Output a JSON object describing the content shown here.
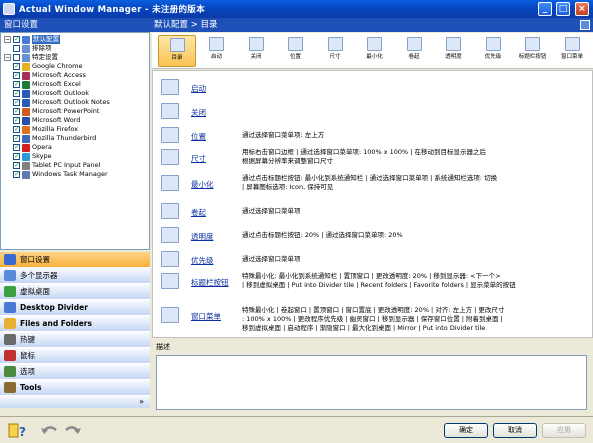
{
  "window": {
    "title": "Actual Window Manager - 未注册的版本",
    "controls": [
      "_",
      "□",
      "×"
    ]
  },
  "left_panel": {
    "header": "窗口设置",
    "tree": [
      {
        "indent": 0,
        "expander": "−",
        "checked": true,
        "icon_color": "#4a7ad8",
        "label": "默认配置",
        "selected": true
      },
      {
        "indent": 1,
        "expander": "",
        "checked": false,
        "icon_color": "#6b8fd0",
        "label": "排除项",
        "selected": false
      },
      {
        "indent": 0,
        "expander": "−",
        "checked": false,
        "icon_color": "#6b8fd0",
        "label": "特定设置",
        "selected": false
      },
      {
        "indent": 1,
        "expander": "",
        "checked": true,
        "icon_color": "#e8b020",
        "label": "Google Chrome",
        "selected": false
      },
      {
        "indent": 1,
        "expander": "",
        "checked": true,
        "icon_color": "#a0305a",
        "label": "Microsoft Access",
        "selected": false
      },
      {
        "indent": 1,
        "expander": "",
        "checked": true,
        "icon_color": "#1f7a3a",
        "label": "Microsoft Excel",
        "selected": false
      },
      {
        "indent": 1,
        "expander": "",
        "checked": true,
        "icon_color": "#2a5ab8",
        "label": "Microsoft Outlook",
        "selected": false
      },
      {
        "indent": 1,
        "expander": "",
        "checked": true,
        "icon_color": "#2a5ab8",
        "label": "Microsoft Outlook Notes",
        "selected": false
      },
      {
        "indent": 1,
        "expander": "",
        "checked": true,
        "icon_color": "#d05a20",
        "label": "Microsoft PowerPoint",
        "selected": false
      },
      {
        "indent": 1,
        "expander": "",
        "checked": true,
        "icon_color": "#2a4ea8",
        "label": "Microsoft Word",
        "selected": false
      },
      {
        "indent": 1,
        "expander": "",
        "checked": true,
        "icon_color": "#e07020",
        "label": "Mozilla Firefox",
        "selected": false
      },
      {
        "indent": 1,
        "expander": "",
        "checked": true,
        "icon_color": "#3a6ac0",
        "label": "Mozilla Thunderbird",
        "selected": false
      },
      {
        "indent": 1,
        "expander": "",
        "checked": true,
        "icon_color": "#d02020",
        "label": "Opera",
        "selected": false
      },
      {
        "indent": 1,
        "expander": "",
        "checked": true,
        "icon_color": "#2a9ad8",
        "label": "Skype",
        "selected": false
      },
      {
        "indent": 1,
        "expander": "",
        "checked": true,
        "icon_color": "#808080",
        "label": "Tablet PC Input Panel",
        "selected": false
      },
      {
        "indent": 1,
        "expander": "",
        "checked": true,
        "icon_color": "#5a7ab0",
        "label": "Windows Task Manager",
        "selected": false
      }
    ],
    "nav": [
      {
        "label": "窗口设置",
        "bold": false,
        "active": true,
        "icon_color": "#3a6ad0"
      },
      {
        "label": "多个显示器",
        "bold": false,
        "active": false,
        "icon_color": "#5a8ad8"
      },
      {
        "label": "虚拟桌面",
        "bold": false,
        "active": false,
        "icon_color": "#3aa040"
      },
      {
        "label": "Desktop Divider",
        "bold": true,
        "active": false,
        "icon_color": "#4a7ad8"
      },
      {
        "label": "Files and Folders",
        "bold": true,
        "active": false,
        "icon_color": "#e8b030"
      },
      {
        "label": "热键",
        "bold": false,
        "active": false,
        "icon_color": "#6a6a6a"
      },
      {
        "label": "鼠标",
        "bold": false,
        "active": false,
        "icon_color": "#c03030"
      },
      {
        "label": "选项",
        "bold": false,
        "active": false,
        "icon_color": "#4a8a40"
      },
      {
        "label": "Tools",
        "bold": true,
        "active": false,
        "icon_color": "#8a6a30"
      }
    ],
    "more_glyph": "»"
  },
  "right_panel": {
    "breadcrumb": "默认配置 > 目录"
  },
  "toolbar": [
    {
      "label": "目录",
      "selected": true
    },
    {
      "label": "启动",
      "selected": false
    },
    {
      "label": "关闭",
      "selected": false
    },
    {
      "label": "位置",
      "selected": false
    },
    {
      "label": "尺寸",
      "selected": false
    },
    {
      "label": "最小化",
      "selected": false
    },
    {
      "label": "卷起",
      "selected": false
    },
    {
      "label": "透明度",
      "selected": false
    },
    {
      "label": "优先级",
      "selected": false
    },
    {
      "label": "标题栏按钮",
      "selected": false
    },
    {
      "label": "窗口菜单",
      "selected": false
    }
  ],
  "rows": [
    {
      "link": "启动",
      "desc_lines": [
        ""
      ]
    },
    {
      "link": "关闭",
      "desc_lines": [
        ""
      ]
    },
    {
      "link": "位置",
      "desc_lines": [
        "通过选择窗口菜单项: 左上方"
      ]
    },
    {
      "link": "尺寸",
      "desc_lines": [
        "用标右击窗口边框 | 通过选择窗口菜单项: 100% x 100% | 在移动到目标显示器之后",
        "根据屏幕分辨率来调整窗口尺寸"
      ]
    },
    {
      "link": "最小化",
      "desc_lines": [
        "通过点击标题栏按钮: 最小化到系统通知栏 | 通过选择窗口菜单项 | 系统通知栏选项: 切换",
        "| 屏幕图标选项: Icon, 保持可见"
      ]
    },
    {
      "link": "卷起",
      "desc_lines": [
        "通过选择窗口菜单项"
      ]
    },
    {
      "link": "透明度",
      "desc_lines": [
        "通过点击标题栏按钮: 20% | 通过选择窗口菜单项: 20%"
      ]
    },
    {
      "link": "优先级",
      "desc_lines": [
        "通过选择窗口菜单项"
      ]
    },
    {
      "link": "标题栏按钮",
      "desc_lines": [
        "特殊最小化: 最小化到系统通知栏 | 置顶窗口 | 更改透明度: 20% | 移到显示器: <下一个>",
        "| 移到虚拟桌面 | Put into Divider tile | Recent folders | Favorite folders | 显示菜单的按钮"
      ]
    },
    {
      "link": "窗口菜单",
      "desc_lines": [
        "特殊最小化 | 卷起窗口 | 置顶窗口 | 窗口置底 | 更改透明度: 20% | 对齐: 左上方 | 更改尺寸",
        ": 100% x 100% | 更改程序优先级 | 幽灵窗口 | 移到显示器 | 保存窗口位置 | 附着到桌面 |",
        "移到虚拟桌面 | 启动程序 | 渐隐窗口 | 最大化到桌面 | Mirror | Put into Divider tile"
      ]
    }
  ],
  "description": {
    "label": "描述",
    "text": ""
  },
  "bottom": {
    "ok": "确定",
    "cancel": "取消",
    "apply": "应用"
  }
}
